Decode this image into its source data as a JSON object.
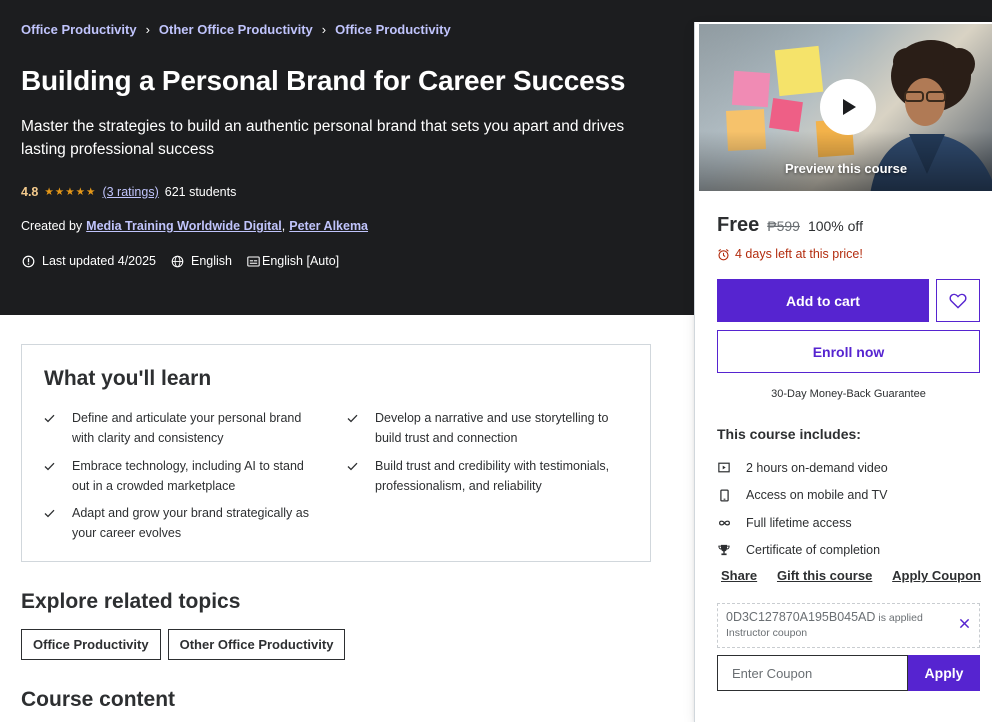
{
  "breadcrumb": [
    "Office Productivity",
    "Other Office Productivity",
    "Office Productivity"
  ],
  "breadcrumb_separator": "›",
  "course": {
    "title": "Building a Personal Brand for Career Success",
    "subtitle": "Master the strategies to build an authentic personal brand that sets you apart and drives lasting professional success",
    "rating": "4.8",
    "stars": "★★★★★",
    "ratings_count": "(3 ratings)",
    "students": "621 students",
    "created_by_label": "Created by",
    "instructors": [
      "Media Training Worldwide Digital",
      "Peter Alkema"
    ],
    "instructor_separator": ",",
    "last_updated": "Last updated 4/2025",
    "language": "English",
    "captions": "English [Auto]"
  },
  "sidebar": {
    "preview_label": "Preview this course",
    "price_free": "Free",
    "price_original": "₱599",
    "discount": "100% off",
    "timer": "4 days left at this price!",
    "add_to_cart": "Add to cart",
    "enroll_now": "Enroll now",
    "guarantee": "30-Day Money-Back Guarantee",
    "includes_title": "This course includes:",
    "includes": [
      {
        "icon": "video-icon",
        "label": "2 hours on-demand video"
      },
      {
        "icon": "mobile-icon",
        "label": "Access on mobile and TV"
      },
      {
        "icon": "infinity-icon",
        "label": "Full lifetime access"
      },
      {
        "icon": "trophy-icon",
        "label": "Certificate of completion"
      }
    ],
    "share": "Share",
    "gift": "Gift this course",
    "apply_coupon": "Apply Coupon",
    "coupon_code": "0D3C127870A195B045AD",
    "coupon_applied_text": "is applied",
    "coupon_note": "Instructor coupon",
    "coupon_placeholder": "Enter Coupon",
    "apply_button": "Apply"
  },
  "learn": {
    "title": "What you'll learn",
    "items": [
      "Define and articulate your personal brand with clarity and consistency",
      "Develop a narrative and use storytelling to build trust and connection",
      "Embrace technology, including AI to stand out in a crowded marketplace",
      "Build trust and credibility with testimonials, professionalism, and reliability",
      "Adapt and grow your brand strategically as your career evolves"
    ]
  },
  "explore": {
    "title": "Explore related topics",
    "topics": [
      "Office Productivity",
      "Other Office Productivity"
    ]
  },
  "content_title": "Course content",
  "colors": {
    "hero_bg": "#1c1d1f",
    "accent": "#5624d0",
    "link_light": "#c0c4fc",
    "rating": "#f3ca8c",
    "star": "#e59819",
    "timer": "#b32d0f"
  }
}
